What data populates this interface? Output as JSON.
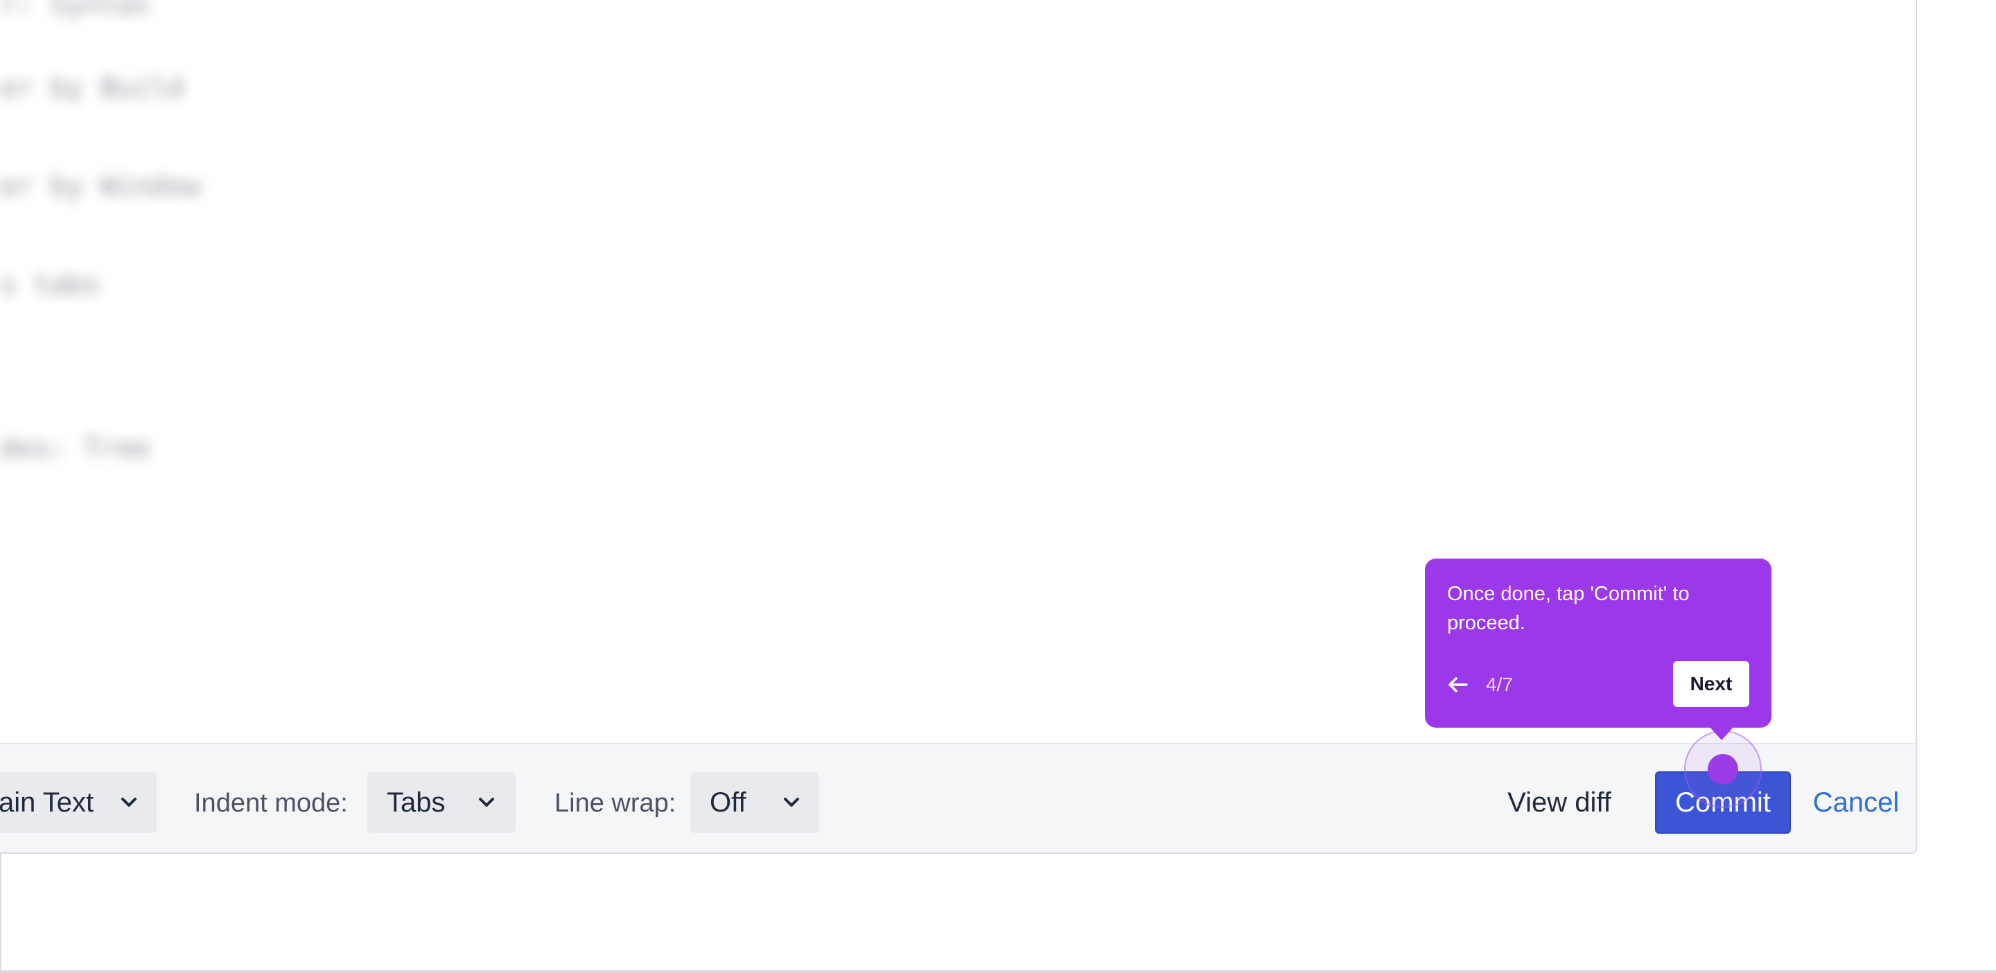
{
  "editor": {
    "blurred_lines": [
      "r: Syntax",
      "er by Build",
      "er by Window",
      "s tabs",
      "des: Tree"
    ]
  },
  "footer": {
    "syntax_value": "ain Text",
    "indent_label": "Indent mode:",
    "indent_value": "Tabs",
    "wrap_label": "Line wrap:",
    "wrap_value": "Off",
    "view_diff_label": "View diff",
    "commit_label": "Commit",
    "cancel_label": "Cancel"
  },
  "tour": {
    "message": "Once done, tap 'Commit' to proceed.",
    "step": "4/7",
    "next_label": "Next",
    "back_icon": "arrow-left-icon"
  },
  "colors": {
    "tooltip_bg": "#9b38ea",
    "commit_bg": "#3b55d6",
    "cancel_text": "#2f6fd6",
    "footer_bg": "#f5f6f8"
  }
}
